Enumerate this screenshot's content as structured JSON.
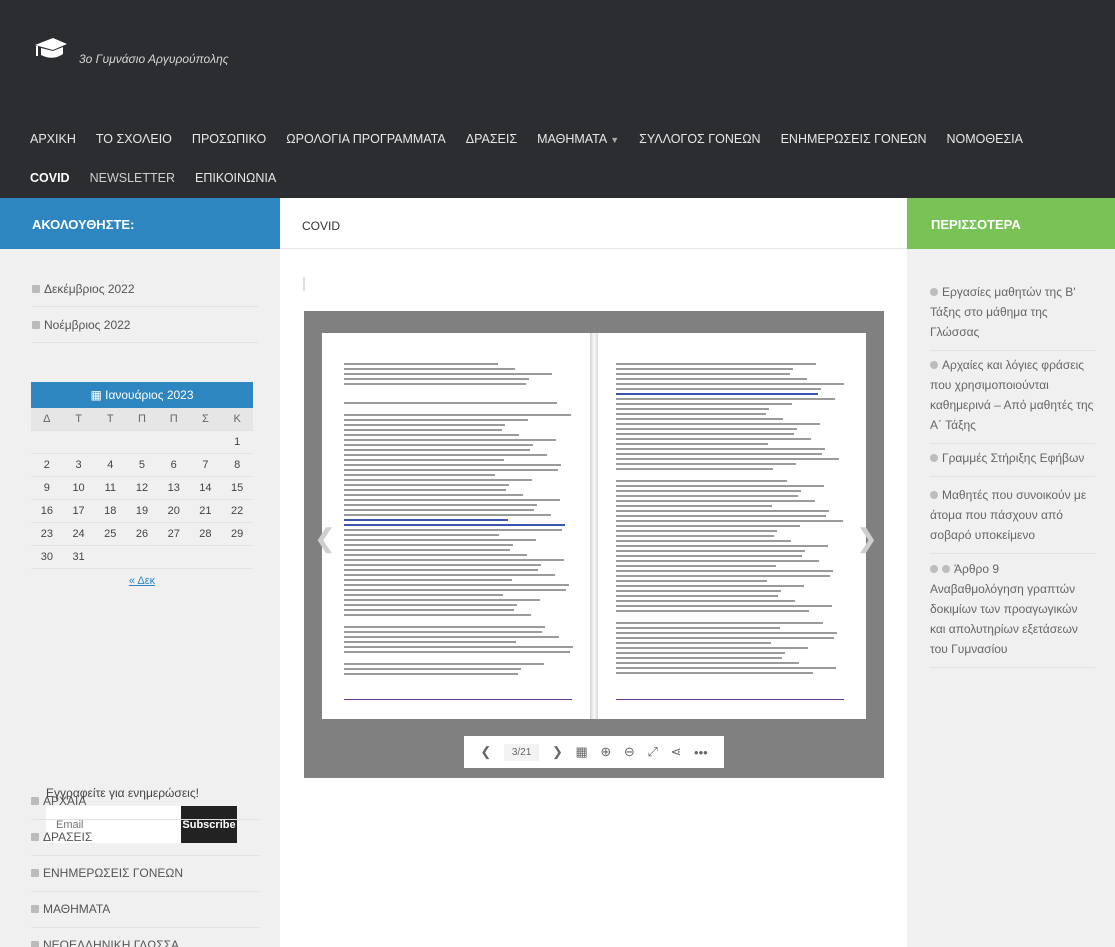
{
  "site": {
    "title": "3ο Γυμνάσιο Αργυρούπολης",
    "logo_icon": "graduation-cap-icon"
  },
  "nav": {
    "row1": [
      "ΑΡΧΙΚΗ",
      "ΤΟ ΣΧΟΛΕΙΟ",
      "ΠΡΟΣΩΠΙΚΟ",
      "ΩΡΟΛΟΓΙΑ ΠΡΟΓΡΑΜΜΑΤΑ",
      "ΔΡΑΣΕΙΣ",
      "ΜΑΘΗΜΑΤΑ",
      "ΣΥΛΛΟΓΟΣ ΓΟΝΕΩΝ",
      "ΕΝΗΜΕΡΩΣΕΙΣ ΓΟΝΕΩΝ",
      "ΝΟΜΟΘΕΣΙΑ"
    ],
    "row2": [
      "COVID",
      "NEWSLETTER",
      "ΕΠΙΚΟΙΝΩΝΙΑ"
    ]
  },
  "subbar": {
    "left": "ΑΚΟΛΟΥΘΗΣΤΕ:",
    "mid": "COVID",
    "right": "ΠΕΡΙΣΣΟΤΕΡΑ"
  },
  "archives": [
    "Δεκέμβριος 2022",
    "Νοέμβριος 2022"
  ],
  "calendar": {
    "title": "Ιανουάριος 2023",
    "days": [
      "Δ",
      "Τ",
      "Τ",
      "Π",
      "Π",
      "Σ",
      "Κ"
    ],
    "weeks": [
      [
        "",
        "",
        "",
        "",
        "",
        "",
        "1"
      ],
      [
        "2",
        "3",
        "4",
        "5",
        "6",
        "7",
        "8"
      ],
      [
        "9",
        "10",
        "11",
        "12",
        "13",
        "14",
        "15"
      ],
      [
        "16",
        "17",
        "18",
        "19",
        "20",
        "21",
        "22"
      ],
      [
        "23",
        "24",
        "25",
        "26",
        "27",
        "28",
        "29"
      ],
      [
        "30",
        "31",
        "",
        "",
        "",
        "",
        ""
      ]
    ],
    "prev": "« Δεκ"
  },
  "subscribe": {
    "label": "Εγγραφείτε για ενημερώσεις!",
    "placeholder": "Email",
    "button": "Subscribe"
  },
  "categories": [
    "ΑΡΧΑΙΑ",
    "ΔΡΑΣΕΙΣ",
    "ΕΝΗΜΕΡΩΣΕΙΣ ΓΟΝΕΩΝ",
    "ΜΑΘΗΜΑΤΑ",
    "ΝΕΟΕΛΛΗΝΙΚΗ ΓΛΩΣΣΑ"
  ],
  "viewer": {
    "page_indicator": "3/21"
  },
  "more": [
    "Εργασίες μαθητών της Β' Τάξης στο μάθημα της Γλώσσας",
    "Αρχαίες και λόγιες φράσεις που χρησιμοποιούνται καθημερινά – Από μαθητές της Α΄ Τάξης",
    "Γραμμές Στήριξης Εφήβων",
    "Μαθητές που συνοικούν με άτομα που πάσχουν από σοβαρό υποκείμενο",
    "Άρθρο 9 Αναβαθμολόγηση γραπτών δοκιμίων των προαγωγικών και απολυτηρίων εξετάσεων του Γυμνασίου"
  ]
}
